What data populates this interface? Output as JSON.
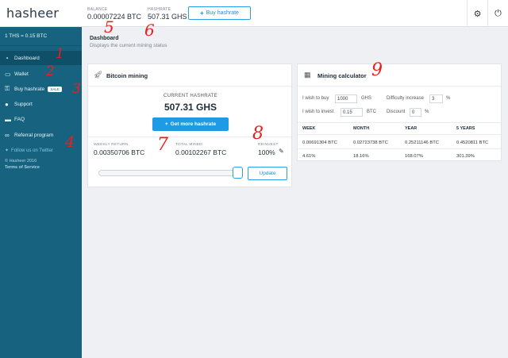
{
  "header": {
    "logo": "hasheer",
    "balance_label": "BALANCE",
    "balance_value": "0.00007224 BTC",
    "hashrate_label": "HASHRATE",
    "hashrate_value": "507.31 GHS",
    "buy_hashrate_label": "Buy hashrate"
  },
  "sidebar": {
    "rate": "1 THS = 0.15 BTC",
    "items": [
      {
        "label": "Dashboard",
        "icon": "dashboard-icon",
        "active": true
      },
      {
        "label": "Wallet",
        "icon": "wallet-icon"
      },
      {
        "label": "Buy hashrate",
        "icon": "cart-icon",
        "badge": "SALE"
      },
      {
        "label": "Support",
        "icon": "user-icon"
      },
      {
        "label": "FAQ",
        "icon": "chat-icon"
      },
      {
        "label": "Referral program",
        "icon": "link-icon"
      }
    ],
    "twitter": "Follow us on Twitter",
    "copyright": "© Hasheer 2016",
    "terms": "Terms of Service"
  },
  "page": {
    "title": "Dashboard",
    "subtitle": "Displays the current mining status"
  },
  "mining": {
    "title": "Bitcoin mining",
    "current_label": "CURRENT HASHRATE",
    "current_value": "507.31 GHS",
    "more_label": "Get more hashrate",
    "weekly_label": "WEEKLY RETURN",
    "weekly_value": "0.00350706 BTC",
    "total_label": "TOTAL MINED",
    "total_value": "0.00102267 BTC",
    "reinvest_label": "REINVEST",
    "reinvest_value": "100%",
    "update_label": "Update",
    "slider_fraction": 1.0
  },
  "calculator": {
    "title": "Mining calculator",
    "buy_label": "I wish to buy",
    "buy_value": "1000",
    "buy_unit": "GHS",
    "difficulty_label": "Difficulty increase",
    "difficulty_value": "3",
    "difficulty_unit": "%",
    "invest_label": "I wish to invest",
    "invest_value": "0.15",
    "invest_unit": "BTC",
    "discount_label": "Discount",
    "discount_value": "0",
    "discount_unit": "%",
    "columns": [
      "WEEK",
      "MONTH",
      "YEAR",
      "5 YEARS"
    ],
    "row_btc": [
      "0.00691304 BTC",
      "0.02723738 BTC",
      "0.25211146 BTC",
      "0.4520811 BTC"
    ],
    "row_pct": [
      "4.61%",
      "18.16%",
      "168.07%",
      "301.39%"
    ]
  },
  "annotations": [
    "1",
    "2",
    "3",
    "4",
    "5",
    "6",
    "7",
    "8",
    "9"
  ],
  "colors": {
    "sidebar": "#17637f",
    "sidebar_active": "#0f4f68",
    "accent": "#1e9be5",
    "annotation": "#e8201e"
  }
}
